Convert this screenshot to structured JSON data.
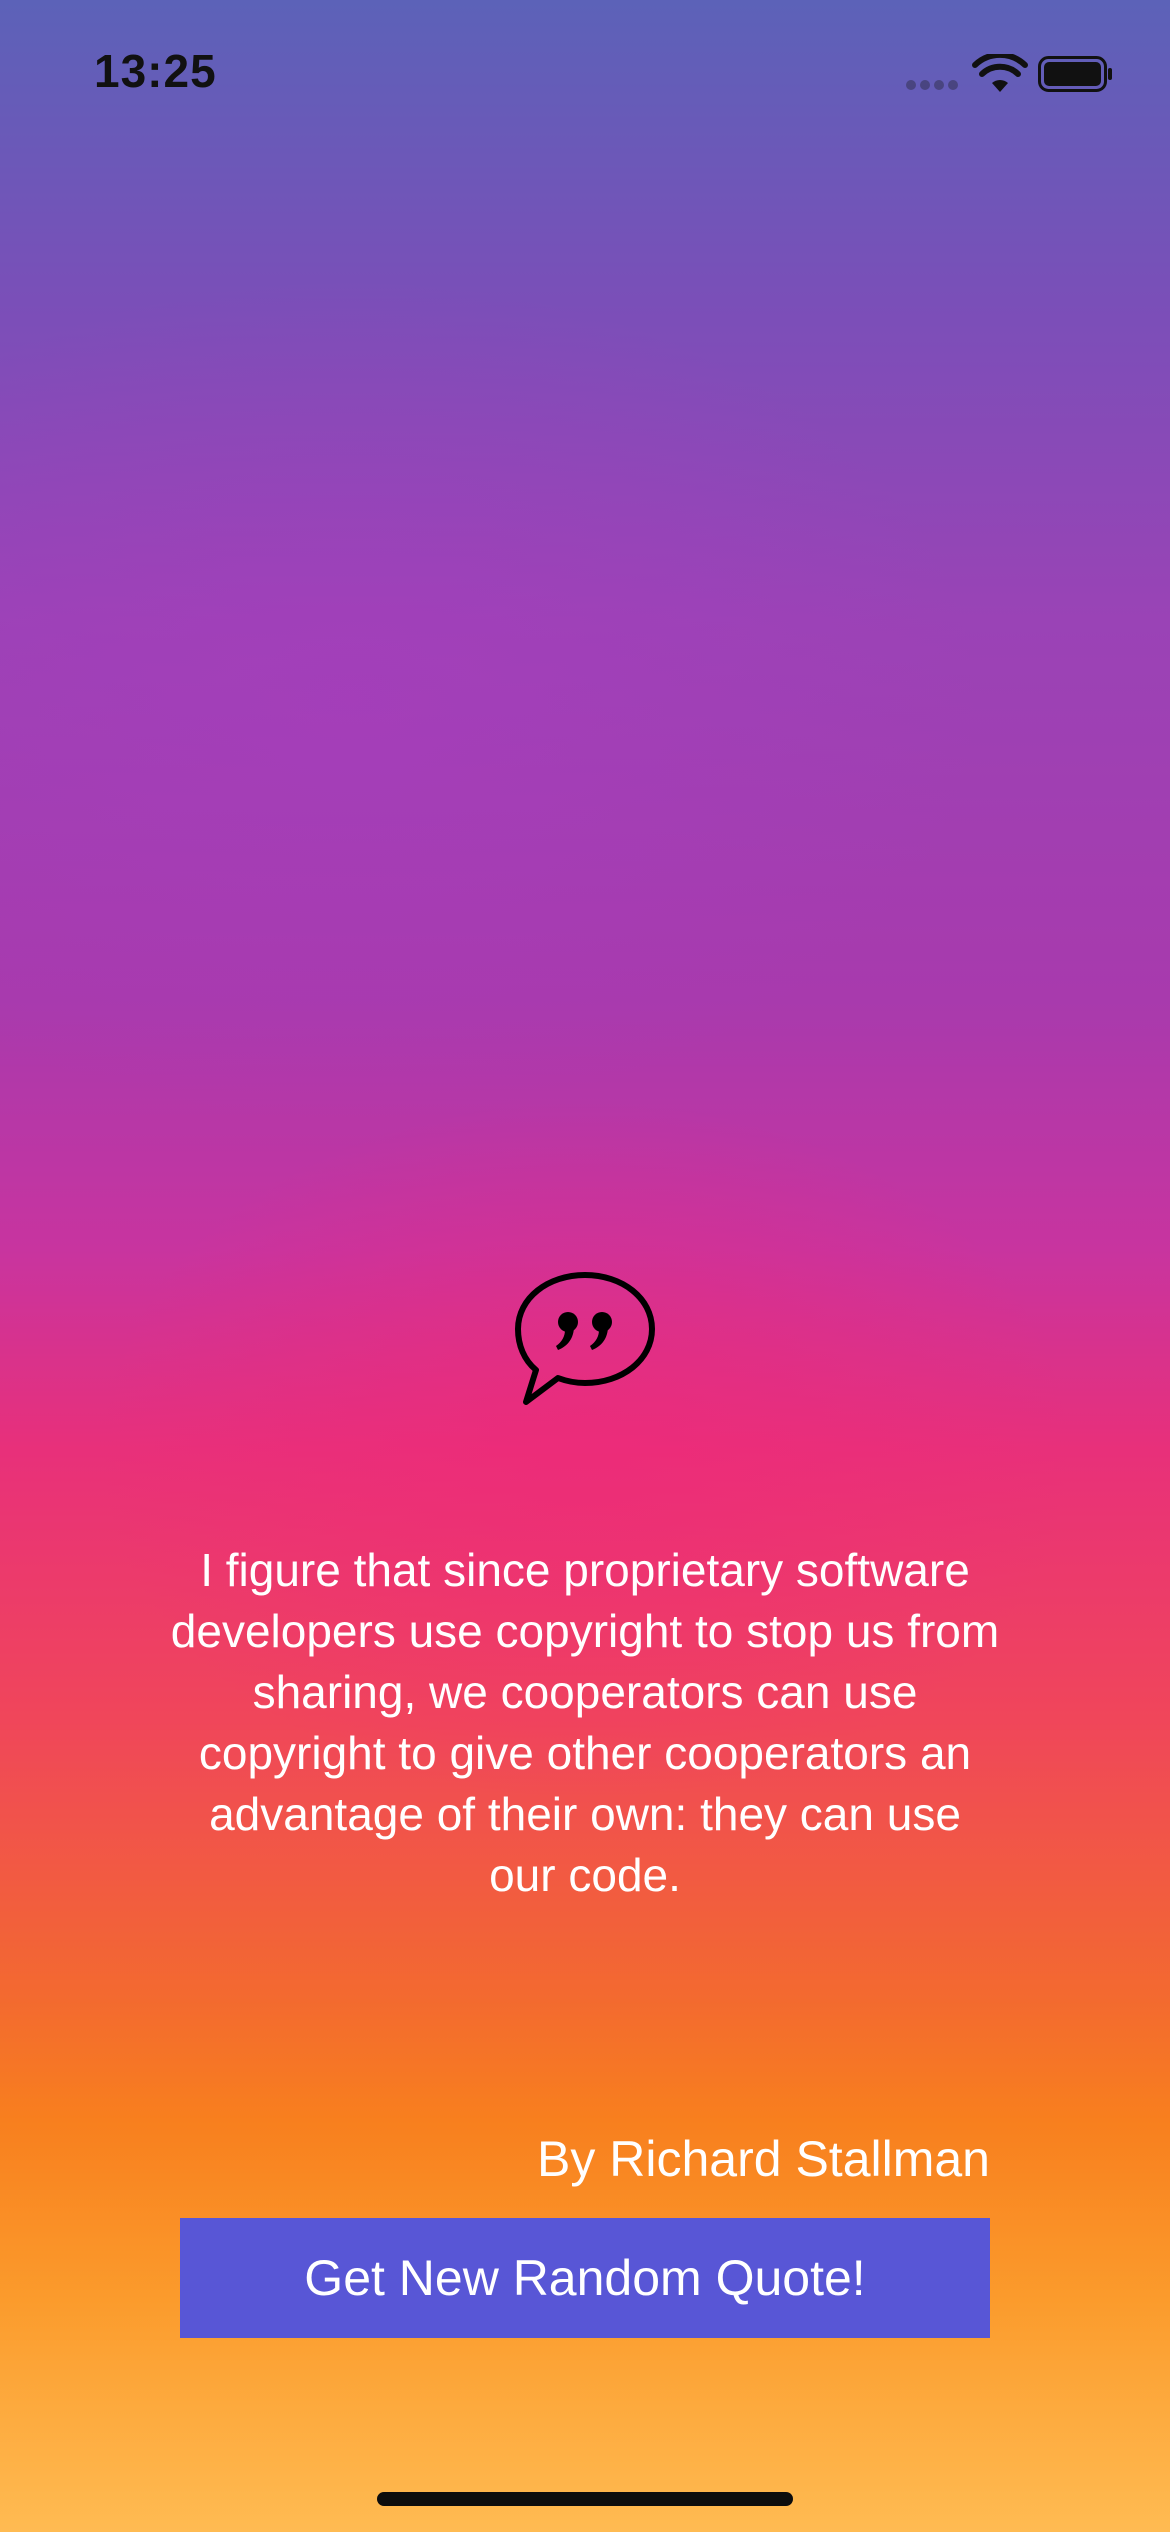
{
  "status_bar": {
    "time": "13:25",
    "icons": [
      "signal-dots-icon",
      "wifi-icon",
      "battery-icon"
    ]
  },
  "quote": {
    "icon": "quote-bubble-icon",
    "text": "I figure that since proprietary software developers use copyright to stop us from sharing, we cooperators can use copyright to give other cooperators an advantage of their own: they can use our code.",
    "author": "By Richard Stallman"
  },
  "actions": {
    "new_quote_label": "Get New Random Quote!"
  },
  "colors": {
    "button_background": "#5856d6",
    "text": "#ffffff",
    "gradient_top": "#5c62b8",
    "gradient_middle": "#e8307a",
    "gradient_bottom": "#ffbb52"
  }
}
